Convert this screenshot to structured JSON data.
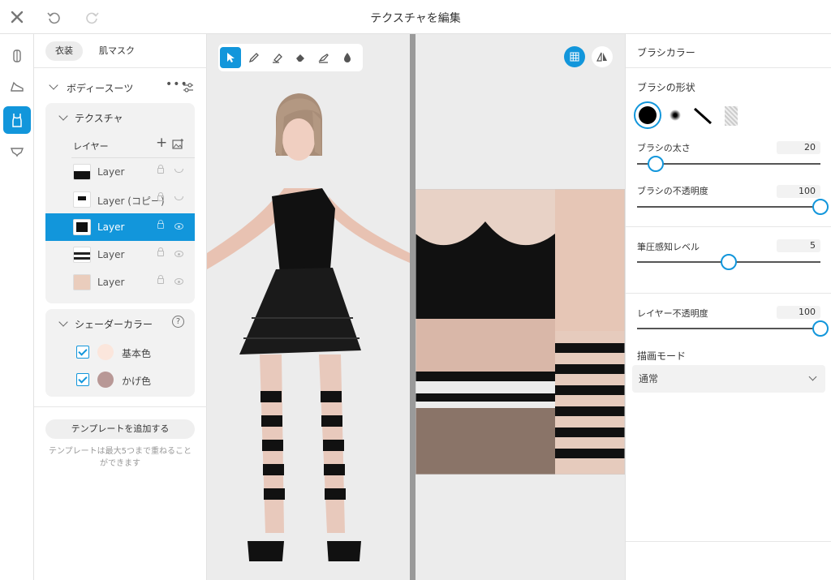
{
  "header": {
    "title": "テクスチャを編集"
  },
  "tabs": [
    {
      "label": "衣装"
    },
    {
      "label": "肌マスク"
    }
  ],
  "group": {
    "title": "ボディースーツ"
  },
  "texture": {
    "title": "テクスチャ",
    "layers_label": "レイヤー",
    "layers": [
      {
        "name": "Layer",
        "visible": false
      },
      {
        "name": "Layer (コピー)",
        "visible": false
      },
      {
        "name": "Layer",
        "visible": true,
        "selected": true
      },
      {
        "name": "Layer",
        "visible": true
      },
      {
        "name": "Layer",
        "visible": true
      }
    ]
  },
  "shader": {
    "title": "シェーダーカラー",
    "colors": [
      {
        "label": "基本色",
        "color": "#fbe6dc",
        "checked": true
      },
      {
        "label": "かげ色",
        "color": "#b89896",
        "checked": true
      }
    ]
  },
  "template": {
    "add_label": "テンプレートを追加する",
    "note": "テンプレートは最大5つまで重ねることができます"
  },
  "brush": {
    "title": "ブラシカラー",
    "color": "#000000",
    "shape_title": "ブラシの形状",
    "size": {
      "label": "ブラシの太さ",
      "value": "20",
      "fraction": 0.1
    },
    "opacity": {
      "label": "ブラシの不透明度",
      "value": "100",
      "fraction": 1.0
    },
    "pressure": {
      "label": "筆圧感知レベル",
      "value": "5",
      "fraction": 0.5
    }
  },
  "layer_settings": {
    "opacity": {
      "label": "レイヤー不透明度",
      "value": "100",
      "fraction": 1.0
    },
    "blend_title": "描画モード",
    "blend_value": "通常"
  },
  "colors": {
    "accent": "#1296db"
  }
}
